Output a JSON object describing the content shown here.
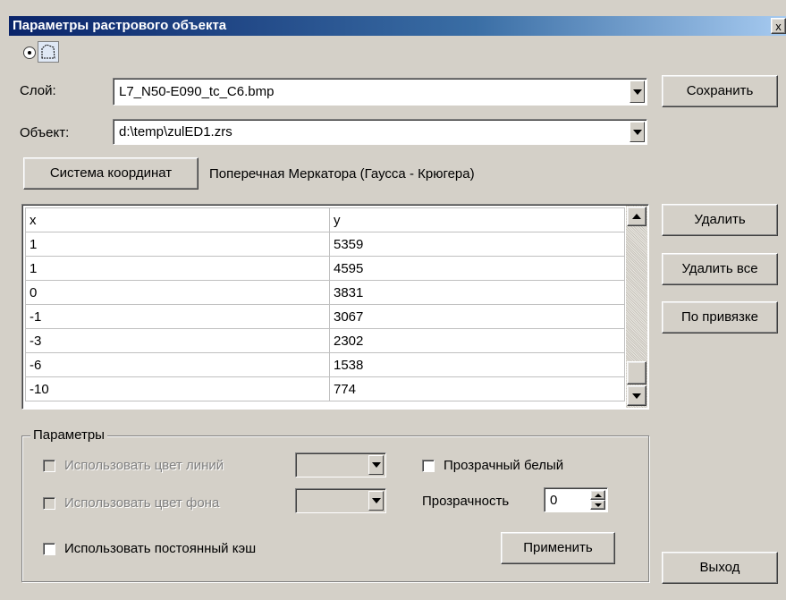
{
  "window": {
    "title": "Параметры растрового объекта",
    "close_label": "x"
  },
  "fields": {
    "layer_label": "Слой:",
    "layer_value": "L7_N50-E090_tc_C6.bmp",
    "object_label": "Объект:",
    "object_value": "d:\\temp\\zulED1.zrs"
  },
  "buttons": {
    "save": "Сохранить",
    "coord_system": "Система координат",
    "delete": "Удалить",
    "delete_all": "Удалить все",
    "by_binding": "По привязке",
    "apply": "Применить",
    "exit": "Выход"
  },
  "coord_system_name": "Поперечная Меркатора (Гаусса - Крюгера)",
  "table": {
    "headers": [
      "x",
      "y"
    ],
    "rows": [
      [
        "1",
        "5359"
      ],
      [
        "1",
        "4595"
      ],
      [
        "0",
        "3831"
      ],
      [
        "-1",
        "3067"
      ],
      [
        "-3",
        "2302"
      ],
      [
        "-6",
        "1538"
      ],
      [
        "-10",
        "774"
      ]
    ]
  },
  "params": {
    "group_label": "Параметры",
    "use_line_color": "Использовать цвет линий",
    "use_bg_color": "Использовать цвет фона",
    "transparent_white": "Прозрачный белый",
    "transparency_label": "Прозрачность",
    "transparency_value": "0",
    "use_cache": "Использовать постоянный кэш"
  },
  "icons": {
    "radio": "radio-selected-icon",
    "polygon": "polygon-select-icon"
  }
}
